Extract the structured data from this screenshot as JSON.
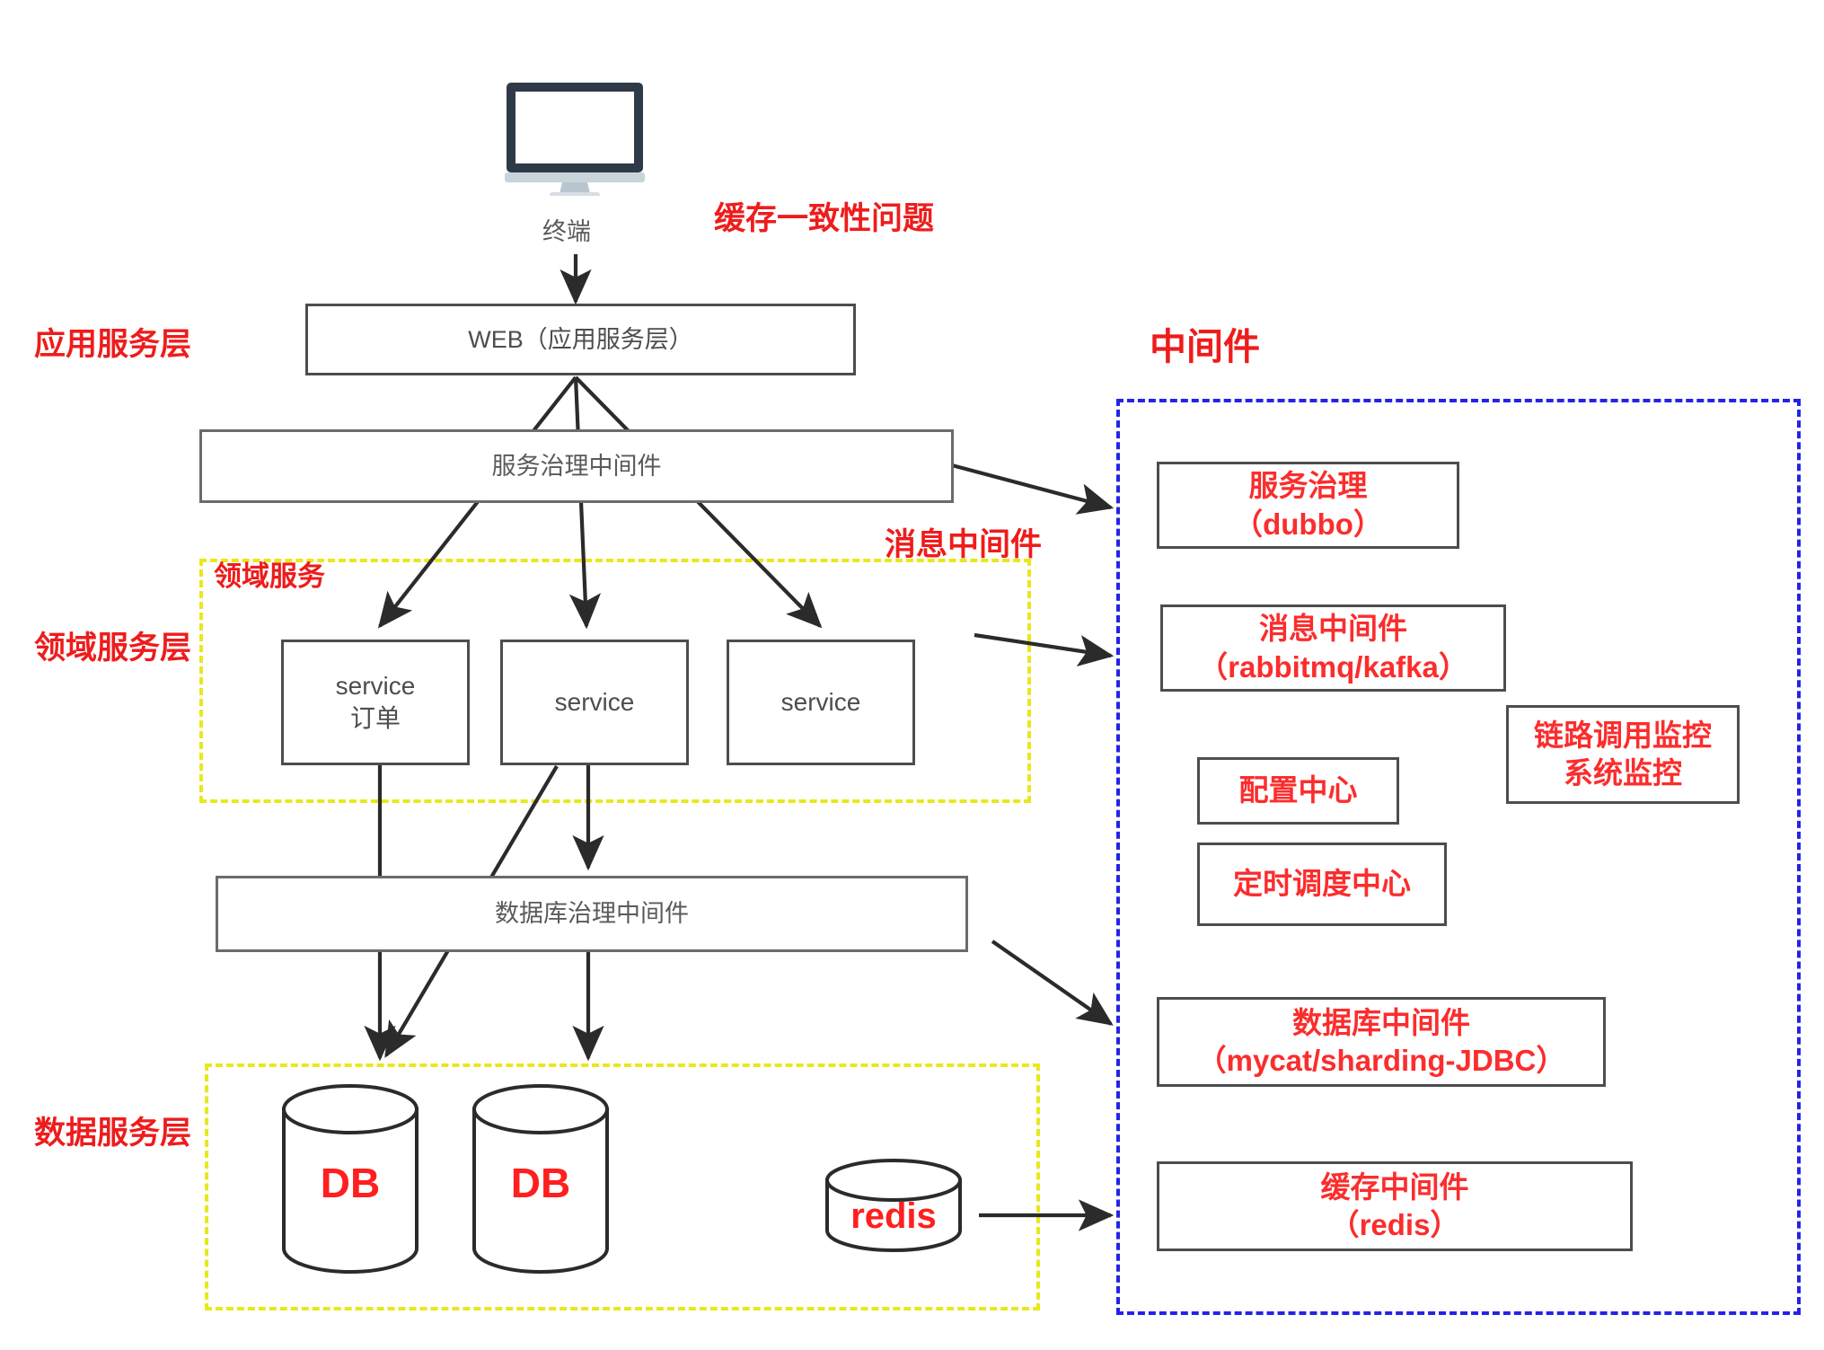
{
  "diagram": {
    "title_annotations": {
      "cache_consistency": "缓存一致性问题",
      "message_middleware": "消息中间件",
      "middleware_panel_title": "中间件",
      "domain_service_group": "领域服务"
    },
    "layer_labels": [
      {
        "id": "app-service-layer",
        "text": "应用服务层"
      },
      {
        "id": "domain-service-layer",
        "text": "领域服务层"
      },
      {
        "id": "data-service-layer",
        "text": "数据服务层"
      }
    ],
    "terminal": {
      "label": "终端",
      "icon": "monitor-icon"
    },
    "web_box": {
      "label": "WEB（应用服务层）"
    },
    "service_governance_bar": {
      "label": "服务治理中间件"
    },
    "services": [
      {
        "line1": "service",
        "line2": "订单"
      },
      {
        "line1": "service",
        "line2": ""
      },
      {
        "line1": "service",
        "line2": ""
      }
    ],
    "db_governance_bar": {
      "label": "数据库治理中间件"
    },
    "datastores": [
      {
        "id": "db-1",
        "label": "DB",
        "kind": "tall-cylinder"
      },
      {
        "id": "db-2",
        "label": "DB",
        "kind": "tall-cylinder"
      },
      {
        "id": "redis",
        "label": "redis",
        "kind": "short-cylinder"
      }
    ],
    "middleware": [
      {
        "id": "service-governance",
        "line1": "服务治理",
        "line2": "（dubbo）"
      },
      {
        "id": "message-middleware",
        "line1": "消息中间件",
        "line2": "（rabbitmq/kafka）"
      },
      {
        "id": "config-center",
        "line1": "配置中心",
        "line2": ""
      },
      {
        "id": "schedule-center",
        "line1": "定时调度中心",
        "line2": ""
      },
      {
        "id": "trace-monitor",
        "line1": "链路调用监控",
        "line2": "系统监控"
      },
      {
        "id": "database-middleware",
        "line1": "数据库中间件",
        "line2": "（mycat/sharding-JDBC）"
      },
      {
        "id": "cache-middleware",
        "line1": "缓存中间件",
        "line2": "（redis）"
      }
    ],
    "colors": {
      "annotation_red": "#ee1c1c",
      "middleware_red": "#fb2d2d",
      "datastore_red": "#ff1f1f",
      "box_outline": "#4d4d4d",
      "yellow_dash": "#e8e81c",
      "blue_dash": "#2323e8",
      "arrow": "#2b2b2b",
      "monitor_bezel": "#2e3a47",
      "monitor_stand": "#c9d3da"
    }
  }
}
